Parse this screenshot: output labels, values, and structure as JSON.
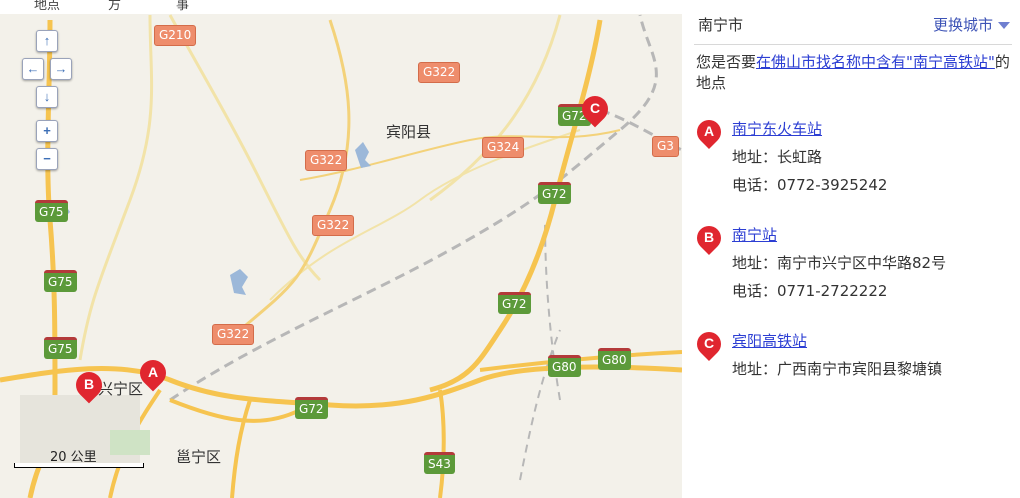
{
  "map": {
    "top_cut_text": [
      "地点",
      "方",
      "事"
    ],
    "nav_controls": {
      "up": "↑",
      "left": "←",
      "right": "→",
      "down": "↓",
      "zoom_in": "+",
      "zoom_out": "−"
    },
    "highways": [
      "G210",
      "G322",
      "G322",
      "G322",
      "G322",
      "G324",
      "G72",
      "G72",
      "G72",
      "G72",
      "G3",
      "G75",
      "G75",
      "G75",
      "G80",
      "G80",
      "S43"
    ],
    "places": [
      "宾阳县",
      "兴宁区",
      "邕宁区"
    ],
    "markers": [
      "A",
      "B",
      "C"
    ],
    "scale_label": "20 公里",
    "colors": {
      "marker": "#e0262f",
      "highway_green": "#5c9a3a",
      "highway_orange": "#ee8d6c",
      "road_yellow": "#f6c450",
      "water": "#9cb8d9"
    }
  },
  "panel": {
    "city": "南宁市",
    "switch_city": "更换城市",
    "prompt": {
      "pre": "您是否要",
      "link1": "在佛山市",
      "mid": "找名称中含有",
      "link2": "\"南宁高铁站\"",
      "post": "的地点"
    },
    "results": [
      {
        "marker": "A",
        "name": "南宁东火车站",
        "address_label": "地址：",
        "address": "长虹路",
        "phone_label": "电话：",
        "phone": "0772-3925242"
      },
      {
        "marker": "B",
        "name": "南宁站",
        "address_label": "地址：",
        "address": "南宁市兴宁区中华路82号",
        "phone_label": "电话：",
        "phone": "0771-2722222"
      },
      {
        "marker": "C",
        "name": "宾阳高铁站",
        "address_label": "地址：",
        "address": "广西南宁市宾阳县黎塘镇"
      }
    ]
  }
}
